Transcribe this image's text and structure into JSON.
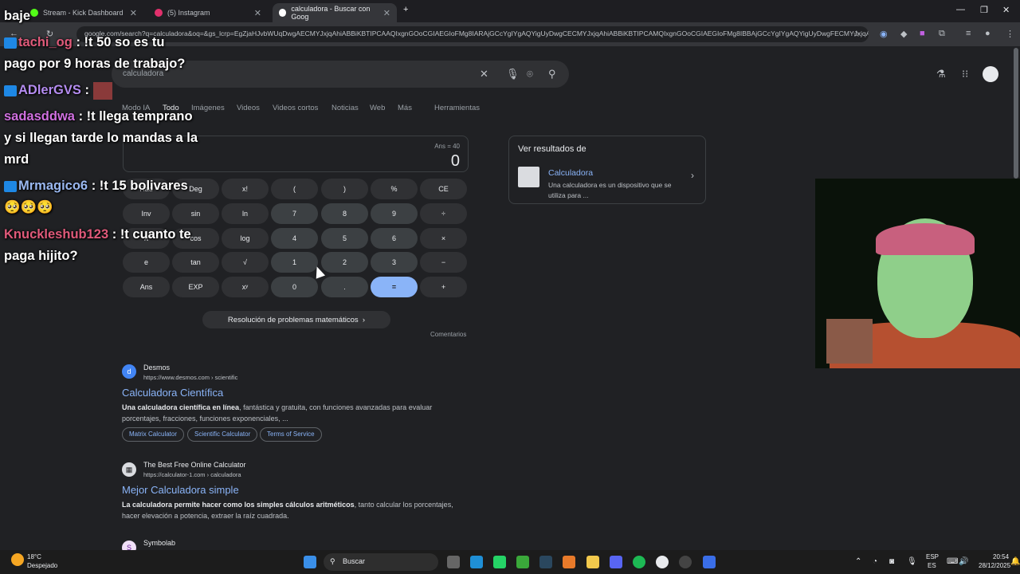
{
  "browser": {
    "tabs": [
      {
        "title": "Stream - Kick Dashboard",
        "active": false
      },
      {
        "title": "(5) Instagram",
        "active": false
      },
      {
        "title": "calculadora - Buscar con Goog",
        "active": true
      }
    ],
    "url": "google.com/search?q=calculadora&oq=&gs_lcrp=EgZjaHJvbWUqDwgAECMYJxjqAhiABBiKBTIPCAAQIxgnGOoCGIAEGIoFMg8IARAjGCcYgIYgAQYigUyDwgCECMYJxjqAhiABBiKBTIPCAMQIxgnGOoCGIAEGIoFMg8IBBAjGCcYgIYgAQYigUyDwgFECMYJxjqAhiABBiKBTIPCAYQIxgnGOoCGIAEGIoFMg8IBxAjGCcYJxjqAh"
  },
  "search": {
    "query": "calculadora",
    "nav": [
      "Modo IA",
      "Todo",
      "Imágenes",
      "Videos",
      "Videos cortos",
      "Noticias",
      "Web",
      "Más",
      "Herramientas"
    ]
  },
  "calculator": {
    "ans": "Ans = 40",
    "display": "0",
    "rows": [
      [
        "Rad",
        "Deg",
        "x!",
        "(",
        ")",
        "%",
        "CE"
      ],
      [
        "Inv",
        "sin",
        "ln",
        "7",
        "8",
        "9",
        "÷"
      ],
      [
        "π",
        "cos",
        "log",
        "4",
        "5",
        "6",
        "×"
      ],
      [
        "e",
        "tan",
        "√",
        "1",
        "2",
        "3",
        "−"
      ],
      [
        "Ans",
        "EXP",
        "xʸ",
        "0",
        ".",
        "=",
        "+"
      ]
    ],
    "solve_label": "Resolución de problemas matemáticos",
    "comments": "Comentarios"
  },
  "results": [
    {
      "source": "Desmos",
      "url": "https://www.desmos.com › scientific",
      "title": "Calculadora Científica",
      "snippet_bold": "Una calculadora científica en línea",
      "snippet": ", fantástica y gratuita, con funciones avanzadas para evaluar porcentajes, fracciones, funciones exponenciales, ...",
      "chips": [
        "Matrix Calculator",
        "Scientific Calculator",
        "Terms of Service"
      ]
    },
    {
      "source": "The Best Free Online Calculator",
      "url": "https://calculator-1.com › calculadora",
      "title": "Mejor Calculadora simple",
      "snippet_bold": "La calculadora permite hacer como los simples cálculos aritméticos",
      "snippet": ", tanto calcular los porcentajes, hacer elevación a potencia, extraer la raíz cuadrada."
    },
    {
      "source": "Symbolab"
    }
  ],
  "knowledge_panel": {
    "header": "Ver resultados de",
    "title": "Calculadora",
    "desc": "Una calculadora es un dispositivo que se utiliza para ..."
  },
  "chat": [
    {
      "user": "",
      "text": "baje",
      "color": "#ffffff"
    },
    {
      "user": "tachi_og",
      "text": ": !t 50 so es tu pago por 9 horas de trabajo?",
      "color": "#e05a7a"
    },
    {
      "user": "ADlerGVS",
      "text": ":",
      "color": "#b48cf0"
    },
    {
      "user": "sadasddwa",
      "text": ": !t llega temprano y si llegan tarde lo mandas a la mrd",
      "color": "#d070e0"
    },
    {
      "user": "Mrmagico6",
      "text": ": !t 15 bolivares 🥺🥺🥺",
      "color": "#9ab8f0"
    },
    {
      "user": "Knuckleshub123",
      "text": ": !t cuanto te paga hijito?",
      "color": "#e05a7a"
    }
  ],
  "taskbar": {
    "weather_temp": "18°C",
    "weather_desc": "Despejado",
    "search": "Buscar",
    "lang1": "ESP",
    "lang2": "ES",
    "time": "20:54",
    "date": "28/12/2025"
  }
}
